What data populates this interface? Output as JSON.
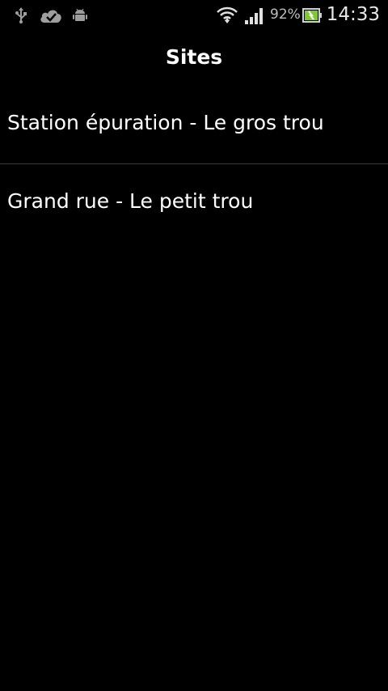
{
  "status_bar": {
    "icons": [
      "usb-icon",
      "cloud-check-icon",
      "android-debug-icon",
      "wifi-icon",
      "signal-icon",
      "battery-icon"
    ],
    "battery_percent": "92%",
    "time": "14:33"
  },
  "header": {
    "title": "Sites"
  },
  "sites": {
    "items": [
      {
        "label": "Station épuration - Le gros trou"
      },
      {
        "label": "Grand rue - Le petit trou"
      }
    ]
  },
  "colors": {
    "background": "#000000",
    "text": "#ffffff",
    "divider": "#3a3a3a",
    "status_icons": "#9e9e9e",
    "battery_fill": "#7ec832"
  }
}
